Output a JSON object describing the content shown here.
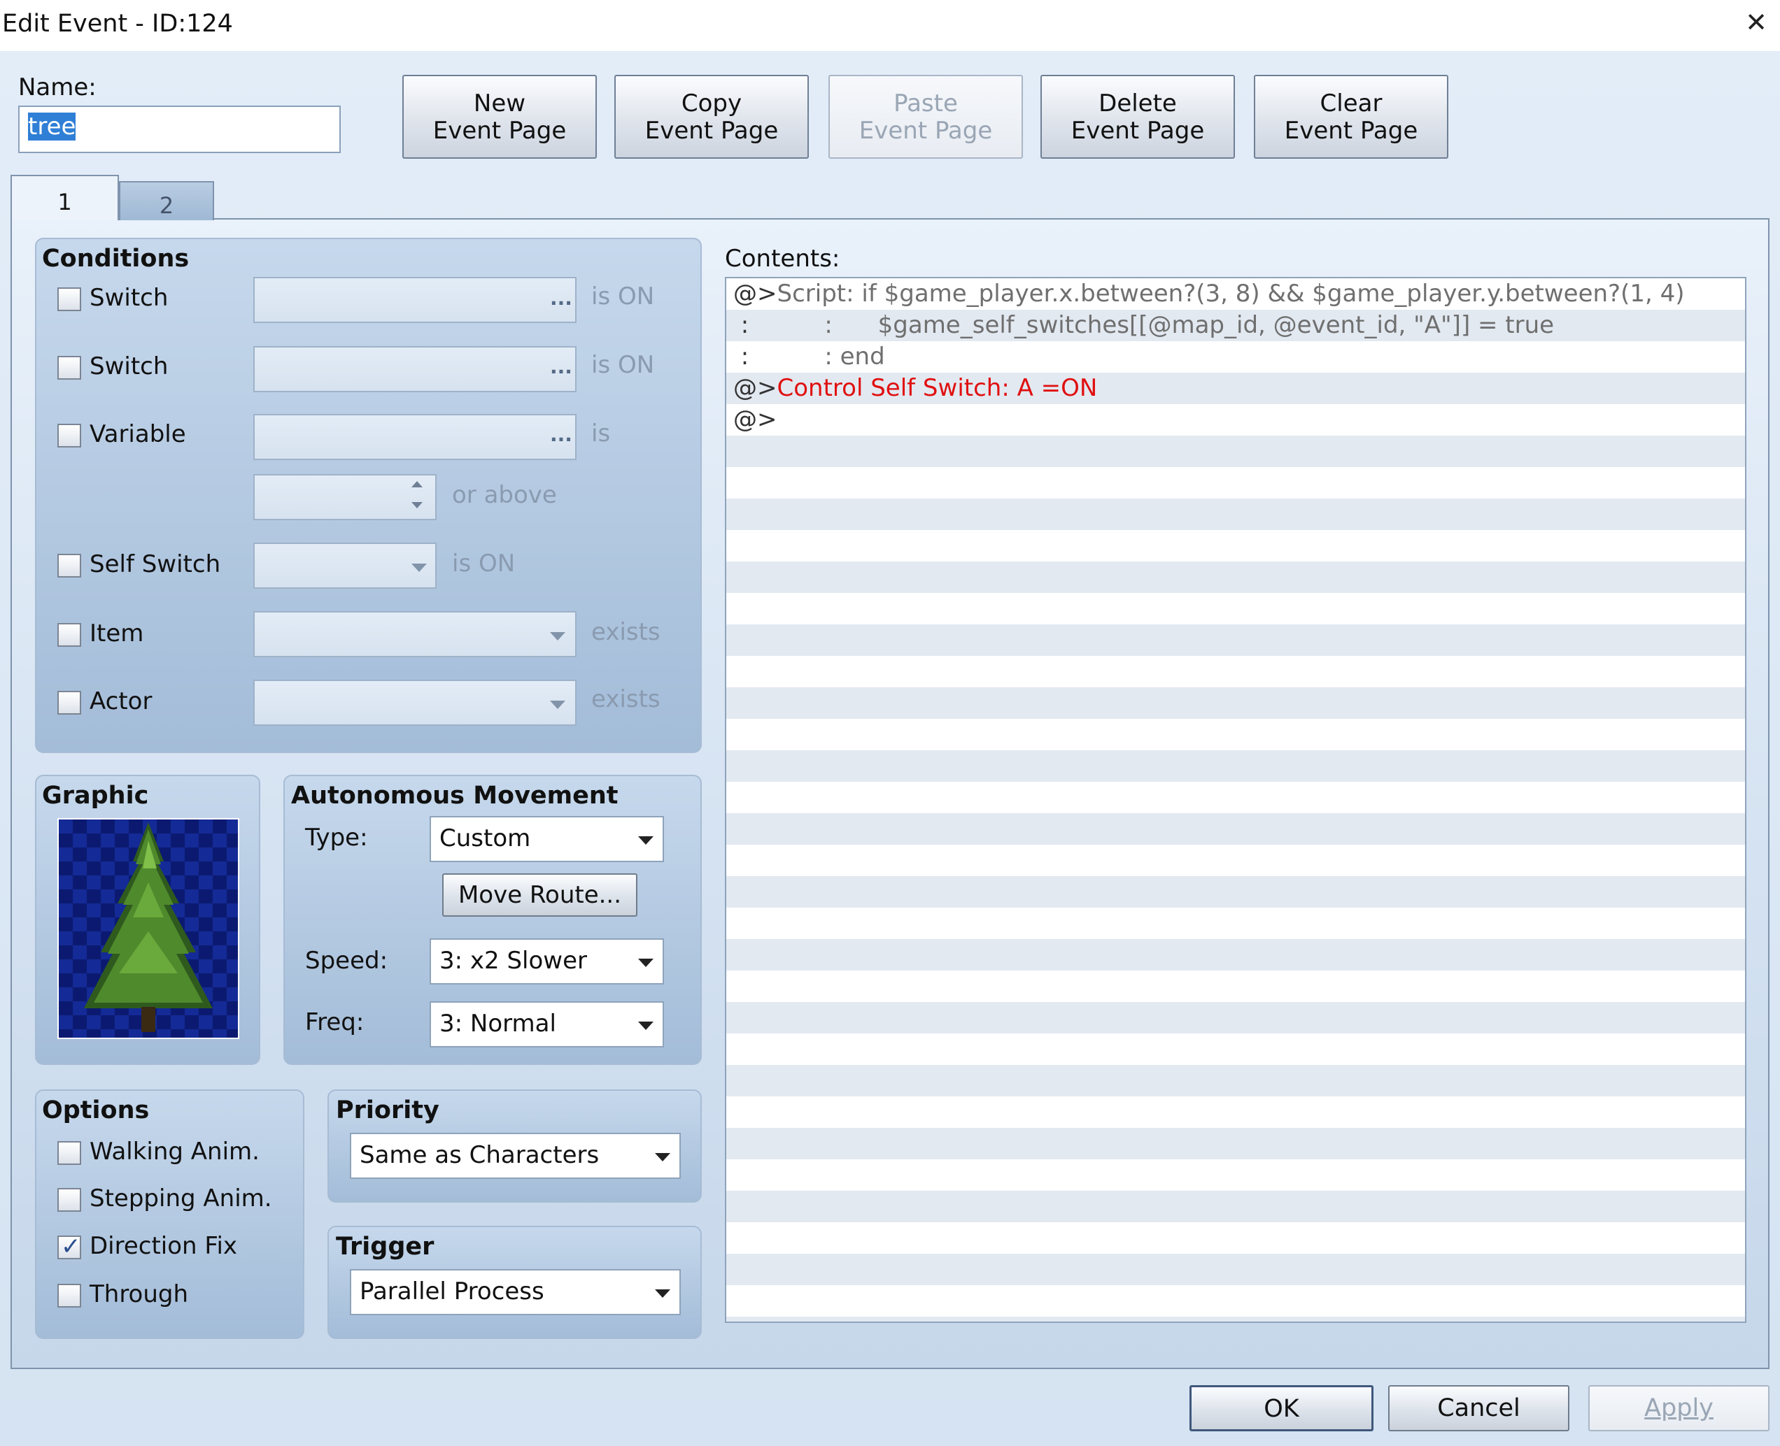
{
  "window": {
    "title": "Edit Event - ID:124",
    "close_glyph": "✕"
  },
  "name": {
    "label": "Name:",
    "value": "tree"
  },
  "toolbar": {
    "new_page": [
      "New",
      "Event Page"
    ],
    "copy_page": [
      "Copy",
      "Event Page"
    ],
    "paste_page": [
      "Paste",
      "Event Page"
    ],
    "delete_page": [
      "Delete",
      "Event Page"
    ],
    "clear_page": [
      "Clear",
      "Event Page"
    ]
  },
  "tabs": [
    {
      "label": "1",
      "active": true
    },
    {
      "label": "2",
      "active": false
    }
  ],
  "conditions": {
    "title": "Conditions",
    "switch1": {
      "label": "Switch",
      "suffix": "is ON",
      "checked": false
    },
    "switch2": {
      "label": "Switch",
      "suffix": "is ON",
      "checked": false
    },
    "variable": {
      "label": "Variable",
      "suffix": "is",
      "or_above": "or above",
      "checked": false
    },
    "self_switch": {
      "label": "Self Switch",
      "suffix": "is ON",
      "checked": false
    },
    "item": {
      "label": "Item",
      "suffix": "exists",
      "checked": false
    },
    "actor": {
      "label": "Actor",
      "suffix": "exists",
      "checked": false
    },
    "ellipsis": "..."
  },
  "graphic": {
    "title": "Graphic"
  },
  "movement": {
    "title": "Autonomous Movement",
    "type_label": "Type:",
    "type_value": "Custom",
    "move_route": "Move Route...",
    "speed_label": "Speed:",
    "speed_value": "3: x2 Slower",
    "freq_label": "Freq:",
    "freq_value": "3: Normal"
  },
  "options": {
    "title": "Options",
    "walking": {
      "label": "Walking Anim.",
      "checked": false
    },
    "stepping": {
      "label": "Stepping Anim.",
      "checked": false
    },
    "direction_fix": {
      "label": "Direction Fix",
      "checked": true
    },
    "through": {
      "label": "Through",
      "checked": false
    }
  },
  "priority": {
    "title": "Priority",
    "value": "Same as Characters"
  },
  "trigger": {
    "title": "Trigger",
    "value": "Parallel Process"
  },
  "contents": {
    "label": "Contents:",
    "lines": [
      {
        "prefix": "@>",
        "text": "Script: if $game_player.x.between?(3, 8) && $game_player.y.between?(1, 4)",
        "color": "gray"
      },
      {
        "prefix": " :",
        "text": "          :      $game_self_switches[[@map_id, @event_id, \"A\"]] = true",
        "color": "gray"
      },
      {
        "prefix": " :",
        "text": "          : end",
        "color": "gray"
      },
      {
        "prefix": "@>",
        "text": "Control Self Switch: A =ON",
        "color": "red"
      },
      {
        "prefix": "@>",
        "text": "",
        "color": "gray"
      }
    ]
  },
  "footer": {
    "ok": "OK",
    "cancel": "Cancel",
    "apply": "Apply"
  },
  "colors": {
    "accent": "#2f7fd6",
    "command_red": "#e01010",
    "panel_blue": "#a3bcd8"
  }
}
